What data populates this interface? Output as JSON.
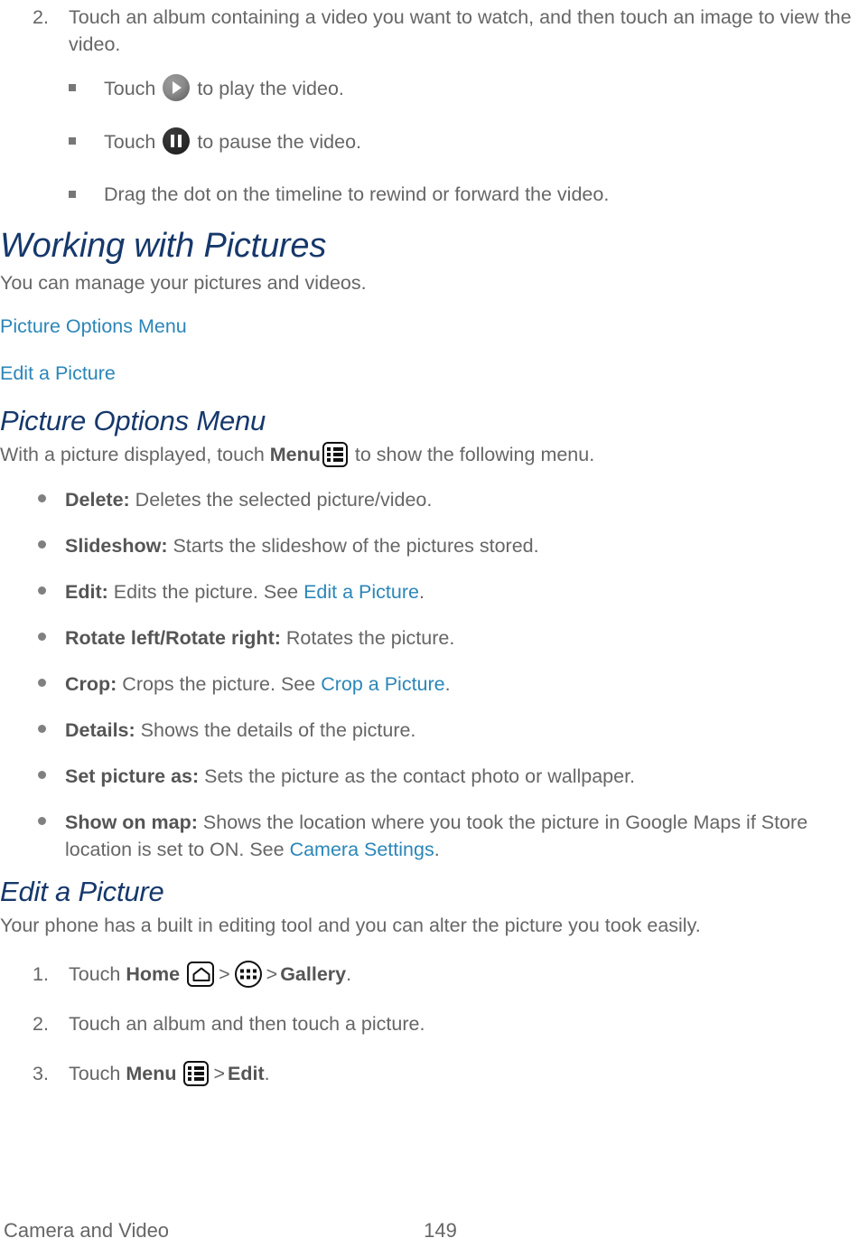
{
  "document": {
    "footer": {
      "section_label": "Camera and Video",
      "page_number": "149"
    },
    "colors": {
      "heading": "#16386b",
      "link": "#2b86b8",
      "body_text": "#666666"
    }
  },
  "step_two": {
    "number": "2.",
    "text": "Touch an album containing a video you want to watch, and then touch an image to view the video."
  },
  "sub_bullets": [
    {
      "prefix": "Touch ",
      "icon": "play-icon",
      "suffix": " to play the video."
    },
    {
      "prefix": "Touch ",
      "icon": "pause-icon",
      "suffix": " to pause the video."
    },
    {
      "prefix": "Drag the dot on the timeline to rewind or forward the video.",
      "icon": "",
      "suffix": ""
    }
  ],
  "working_with_pictures": {
    "heading": "Working with Pictures",
    "intro": "You can manage your pictures and videos.",
    "links": [
      "Picture Options Menu",
      "Edit a Picture"
    ]
  },
  "picture_options_menu": {
    "heading": "Picture Options Menu",
    "intro_before": "With a picture displayed, touch ",
    "intro_bold": "Menu",
    "menu_icon": "menu-list-icon",
    "intro_after": " to show the following menu.",
    "items": [
      {
        "label": "Delete:",
        "text_before": " Deletes the selected picture/video.",
        "link": "",
        "text_after": ""
      },
      {
        "label": "Slideshow:",
        "text_before": " Starts the slideshow of the pictures stored.",
        "link": "",
        "text_after": ""
      },
      {
        "label": "Edit:",
        "text_before": " Edits the picture. See ",
        "link": "Edit a Picture",
        "text_after": "."
      },
      {
        "label": "Rotate left/Rotate right:",
        "text_before": " Rotates the picture.",
        "link": "",
        "text_after": ""
      },
      {
        "label": "Crop:",
        "text_before": " Crops the picture. See ",
        "link": "Crop a Picture",
        "text_after": "."
      },
      {
        "label": "Details:",
        "text_before": " Shows the details of the picture.",
        "link": "",
        "text_after": ""
      },
      {
        "label": "Set picture as:",
        "text_before": " Sets the picture as the contact photo or wallpaper.",
        "link": "",
        "text_after": ""
      },
      {
        "label": "Show on map:",
        "text_before": " Shows the location where you took the picture in Google Maps if Store location is set to ON. See ",
        "link": "Camera Settings",
        "text_after": "."
      }
    ]
  },
  "edit_a_picture": {
    "heading": "Edit a Picture",
    "intro": "Your phone has a built in editing tool and you can alter the picture you took easily.",
    "steps": [
      {
        "number": "1.",
        "text_before": "Touch ",
        "bold_one": "Home",
        "icon_one": "home-icon",
        "separator_one": ">",
        "icon_two": "apps-grid-icon",
        "separator_two": ">",
        "bold_two": "Gallery",
        "text_after": "."
      },
      {
        "number": "2.",
        "text_before": "Touch an album and then touch a picture.",
        "bold_one": "",
        "icon_one": "",
        "separator_one": "",
        "icon_two": "",
        "separator_two": "",
        "bold_two": "",
        "text_after": ""
      },
      {
        "number": "3.",
        "text_before": "Touch ",
        "bold_one": "Menu",
        "icon_one": "menu-list-icon",
        "separator_one": ">",
        "icon_two": "",
        "separator_two": "",
        "bold_two": "Edit",
        "text_after": "."
      }
    ]
  }
}
